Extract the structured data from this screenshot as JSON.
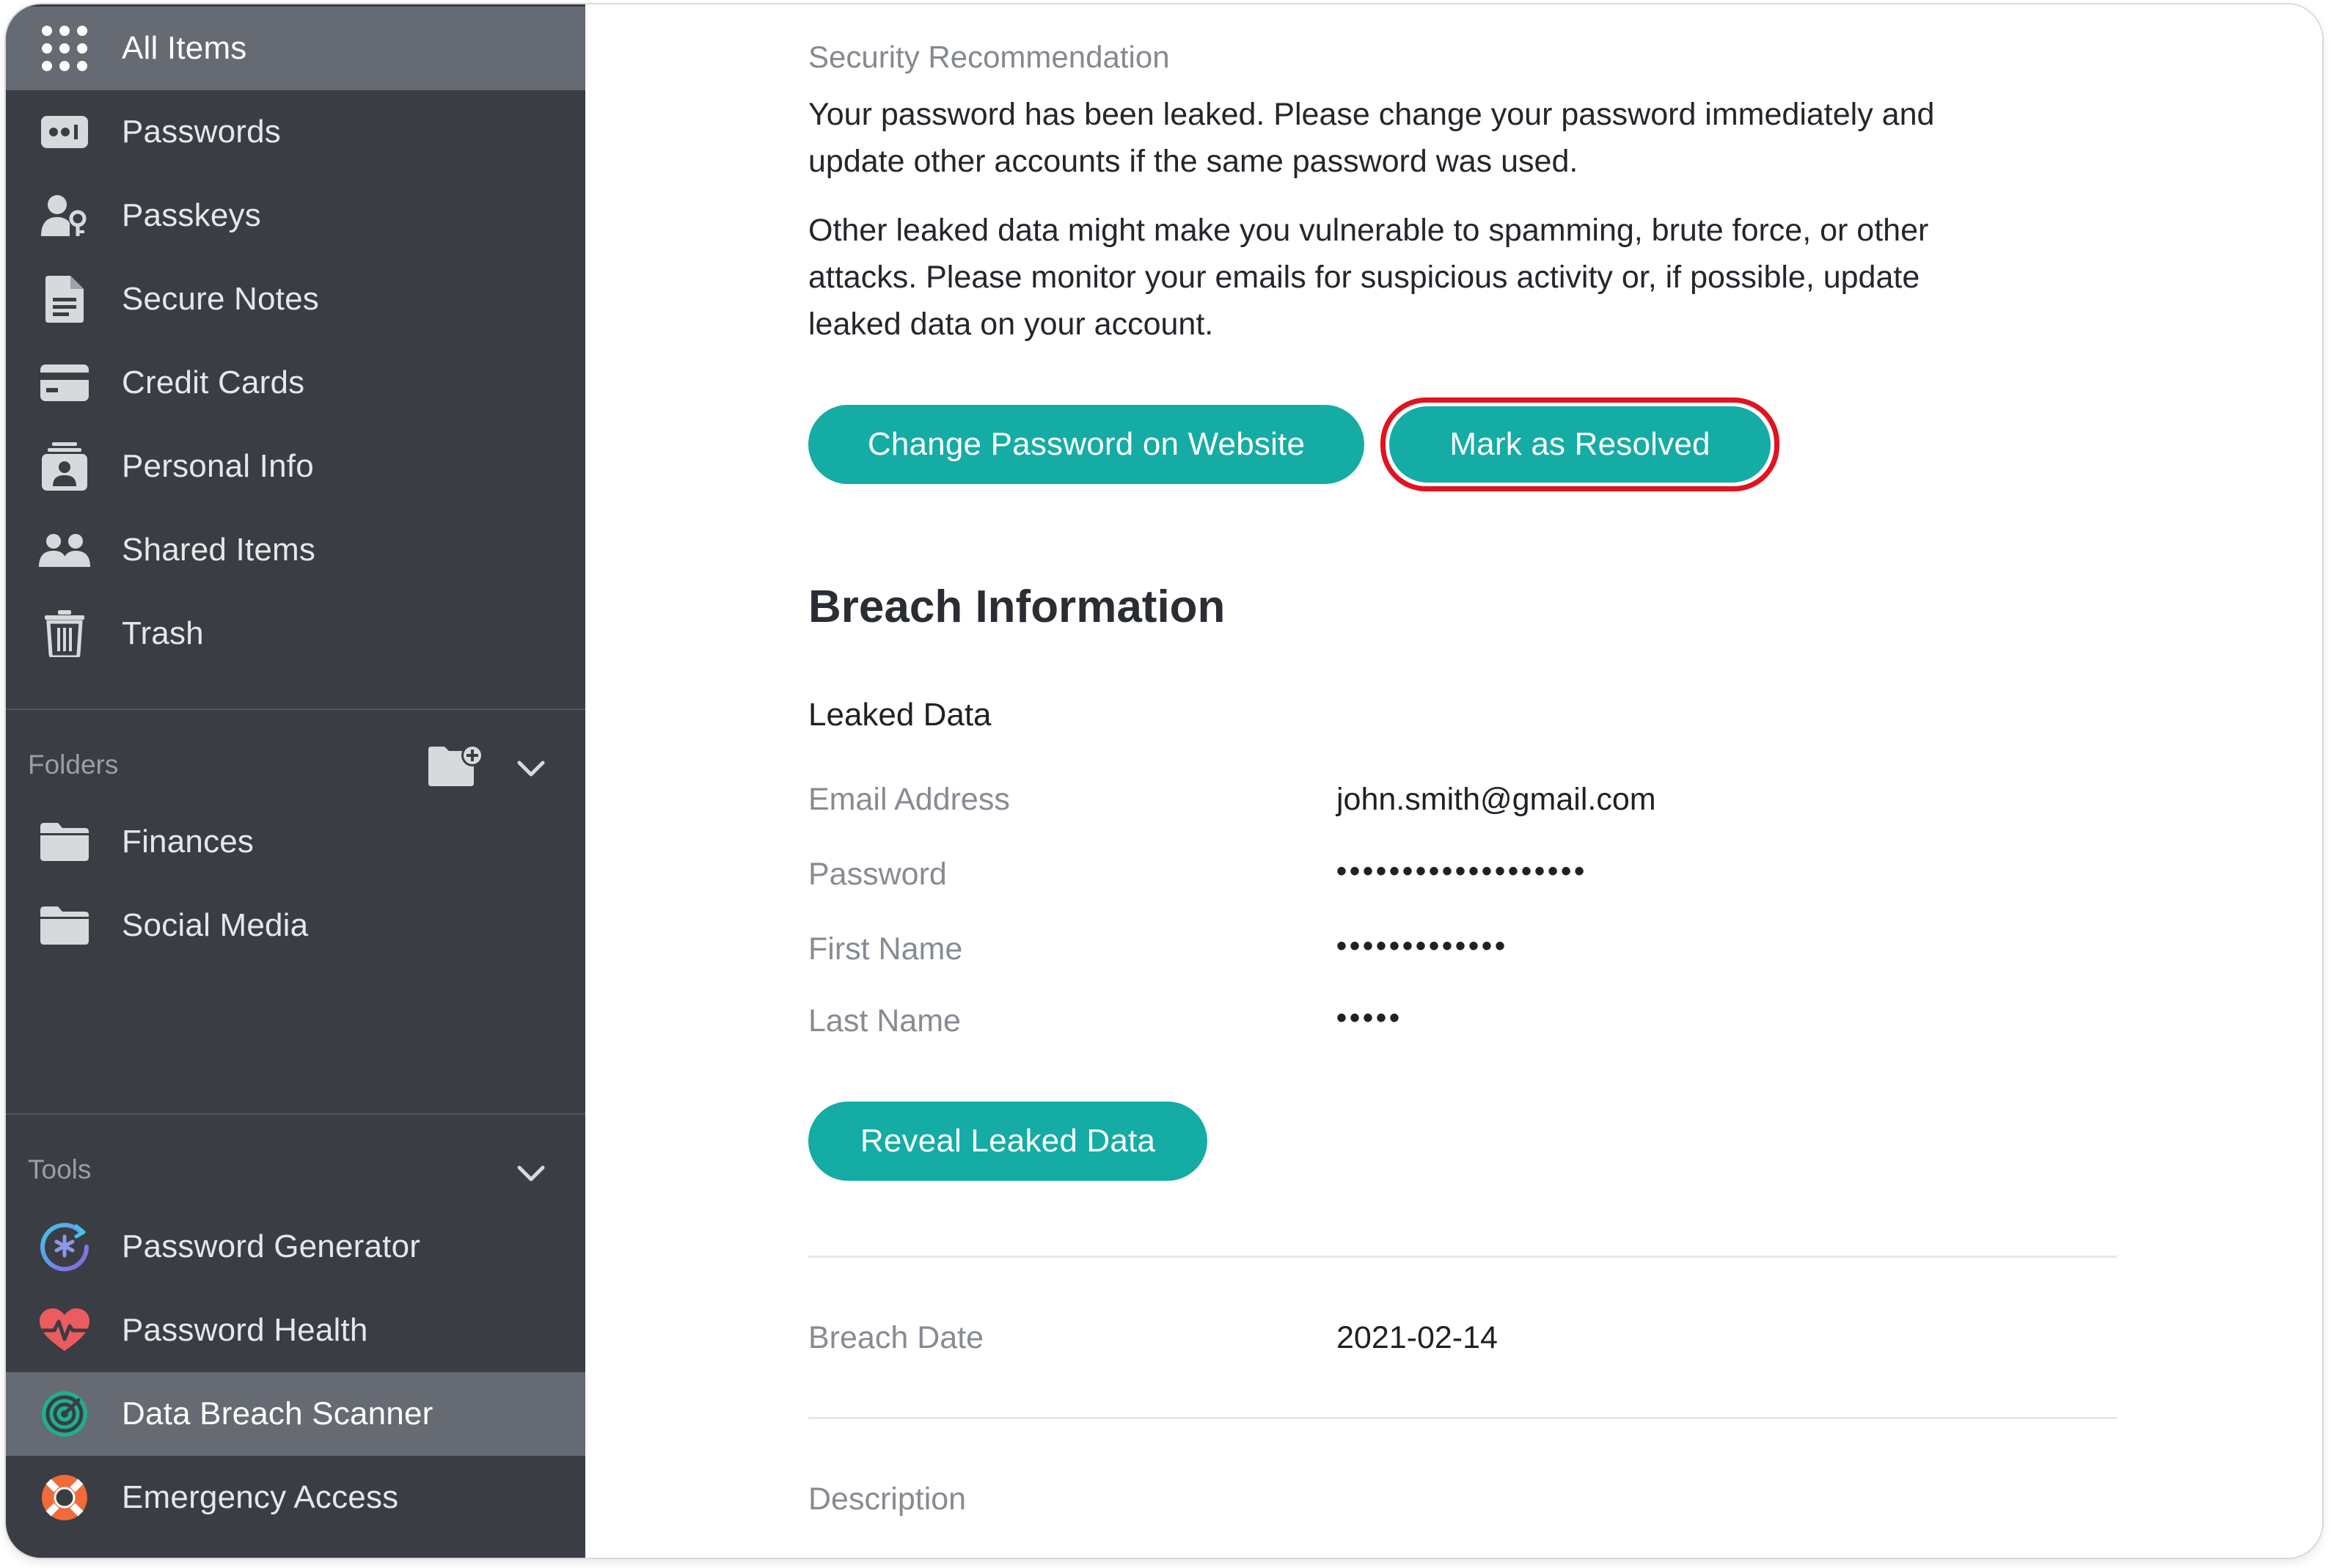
{
  "sidebar": {
    "items": [
      {
        "label": "All Items",
        "icon": "grid-icon"
      },
      {
        "label": "Passwords",
        "icon": "password-icon"
      },
      {
        "label": "Passkeys",
        "icon": "passkey-icon"
      },
      {
        "label": "Secure Notes",
        "icon": "note-icon"
      },
      {
        "label": "Credit Cards",
        "icon": "credit-card-icon"
      },
      {
        "label": "Personal Info",
        "icon": "id-badge-icon"
      },
      {
        "label": "Shared Items",
        "icon": "people-icon"
      },
      {
        "label": "Trash",
        "icon": "trash-icon"
      }
    ],
    "folders": {
      "title": "Folders",
      "items": [
        {
          "label": "Finances",
          "icon": "folder-icon"
        },
        {
          "label": "Social Media",
          "icon": "folder-icon"
        }
      ]
    },
    "tools": {
      "title": "Tools",
      "items": [
        {
          "label": "Password Generator",
          "icon": "password-generator-icon"
        },
        {
          "label": "Password Health",
          "icon": "heart-pulse-icon"
        },
        {
          "label": "Data Breach Scanner",
          "icon": "radar-icon"
        },
        {
          "label": "Emergency Access",
          "icon": "lifebuoy-icon"
        }
      ]
    },
    "active_item": "Data Breach Scanner"
  },
  "main": {
    "recommendation_label": "Security Recommendation",
    "paragraph_1_line_1": "Your password has been leaked. Please change your password immediately and",
    "paragraph_1_line_2": "update other accounts if the same password was used.",
    "paragraph_2_line_1": "Other leaked data might make you vulnerable to spamming, brute force, or other",
    "paragraph_2_line_2": "attacks. Please monitor your emails for suspicious activity or, if possible, update",
    "paragraph_2_line_3": "leaked data on your account.",
    "change_password_button": "Change Password on Website",
    "mark_resolved_button": "Mark as Resolved",
    "breach_heading": "Breach Information",
    "leaked_data_heading": "Leaked Data",
    "leaked_fields": [
      {
        "label": "Email Address",
        "value": "john.smith@gmail.com"
      },
      {
        "label": "Password",
        "value": "•••••••••••••••••••"
      },
      {
        "label": "First Name",
        "value": "•••••••••••••"
      },
      {
        "label": "Last Name",
        "value": "•••••"
      }
    ],
    "reveal_button": "Reveal Leaked Data",
    "breach_date_label": "Breach Date",
    "breach_date_value": "2021-02-14",
    "description_label": "Description"
  },
  "colors": {
    "sidebar_bg": "#3a3d44",
    "sidebar_active": "#666a72",
    "accent": "#14aca5",
    "highlight": "#e0131f"
  }
}
